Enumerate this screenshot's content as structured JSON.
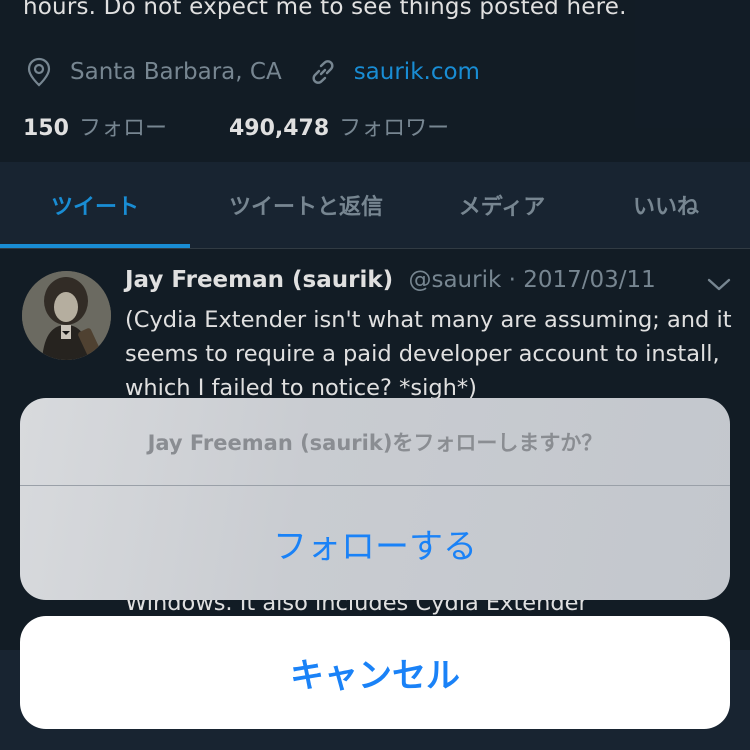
{
  "profile": {
    "bio_tail": "hours. Do not expect me to see things posted here.",
    "location": "Santa Barbara, CA",
    "website": "saurik.com",
    "following_count": "150",
    "following_label": "フォロー",
    "followers_count": "490,478",
    "followers_label": "フォロワー"
  },
  "tabs": [
    {
      "label": "ツイート",
      "active": true
    },
    {
      "label": "ツイートと返信",
      "active": false
    },
    {
      "label": "メディア",
      "active": false
    },
    {
      "label": "いいね",
      "active": false
    }
  ],
  "tweet": {
    "author_name": "Jay Freeman (saurik)",
    "author_handle": "@saurik",
    "separator": "·",
    "date": "2017/03/11",
    "text": "(Cydia Extender isn't what many are assuming; and it seems to require a paid developer account to install, which I failed to notice? *sigh*)"
  },
  "next_tweet_partial": "Windows. It also includes Cydia Extender",
  "action_sheet": {
    "title": "Jay Freeman (saurik)をフォローしますか？",
    "action_label": "フォローする",
    "cancel_label": "キャンセル"
  },
  "icons": {
    "location": "map-pin-icon",
    "website": "link-icon",
    "tweet_menu": "chevron-down-icon"
  },
  "colors": {
    "background": "#15202b",
    "accent": "#1da1f2",
    "secondary_text": "#8899a6",
    "ios_blue": "#1a82f7"
  }
}
